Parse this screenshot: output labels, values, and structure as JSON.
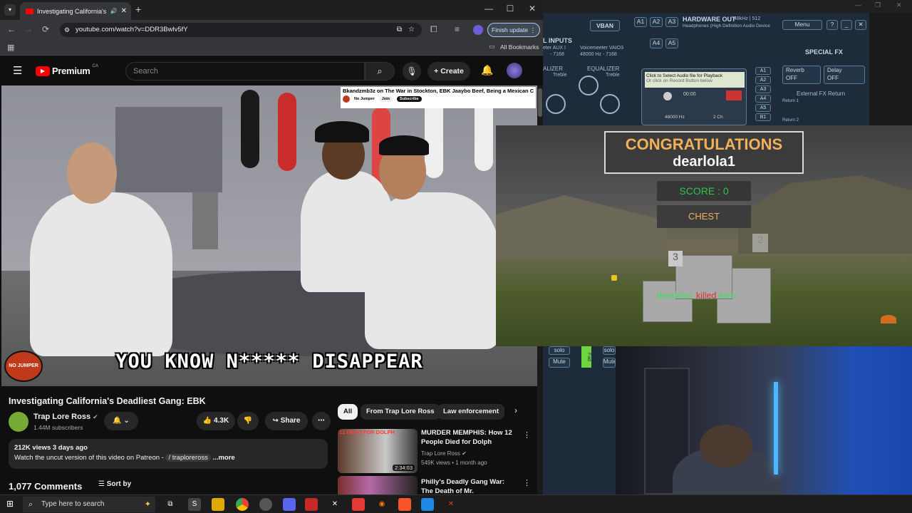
{
  "browser": {
    "tab_title": "Investigating California's De",
    "address": "youtube.com/watch?v=DDR3Bwlv5fY",
    "finish_update": "Finish update",
    "all_bookmarks": "All Bookmarks"
  },
  "youtube": {
    "logo_text": "Premium",
    "logo_region": "CA",
    "search_placeholder": "Search",
    "create_label": "Create",
    "video": {
      "caption": "YOU KNOW N***** DISAPPEAR",
      "logo_text": "NO JUMPER",
      "promo_text": "Bkandzmb3z on The War in Stockton, EBK Jaaybo Beef, Being a Mexican Crip",
      "promo_channel": "No Jumper",
      "promo_join": "Join",
      "promo_subscribe": "Subscribe"
    },
    "title": "Investigating California's Deadliest Gang: EBK",
    "channel_name": "Trap Lore Ross",
    "subscribers": "1.44M subscribers",
    "likes": "4.3K",
    "share_label": "Share",
    "stats": "212K views  3 days ago",
    "description": "Watch the uncut version of this video on Patreon -",
    "description_link": "/ traploreross",
    "more_label": "...more",
    "comments_count": "1,077 Comments",
    "sort_label": "Sort by",
    "chips": [
      "All",
      "From Trap Lore Ross",
      "Law enforcement"
    ],
    "recommendations": [
      {
        "title": "MURDER MEMPHIS: How 12 People Died for Dolph",
        "channel": "Trap Lore Ross",
        "meta": "549K views • 1 month ago",
        "duration": "2:34:03",
        "thumb_text": "12 DEAD FOR DOLPH"
      },
      {
        "title": "Philly's Deadly Gang War: The Death of Mr. Disrespectful",
        "channel": "",
        "meta": "",
        "duration": "",
        "thumb_text": ""
      }
    ]
  },
  "voicemeeter": {
    "vban": "VBAN",
    "hardware_out": "HARDWARE OUT",
    "hw_rate": "48kHz | 512",
    "hw_device": "Headphones (High Definition Audio Device",
    "menu": "Menu",
    "virtual_inputs": "L INPUTS",
    "voicemeeter_aux": "eter AUX I",
    "voicemeeter_vaio": "Voicemeeter VAIO3",
    "rate_left": "- 7168",
    "rate_right": "48000 Hz - 7168",
    "special_fx": "SPECIAL FX",
    "equalizer_1": "ALIZER",
    "equalizer_2": "EQUALIZER",
    "treble": "Treble",
    "playback_hint": "Click to Select Audio file for Playback",
    "record_hint": "Or click on Record Button below",
    "time": "00:00",
    "sample_rate": "48000 Hz",
    "channels": "2 Ch",
    "reverb": "Reverb",
    "reverb_state": "OFF",
    "delay": "Delay",
    "delay_state": "OFF",
    "external_fx": "External FX Return",
    "return1": "Return 1",
    "return2": "Return 2",
    "buses_a": [
      "A1",
      "A2",
      "A3"
    ],
    "buses_b": [
      "A4",
      "A5"
    ],
    "bus_list": [
      "A1",
      "A2",
      "A3",
      "A4",
      "A5",
      "B1"
    ],
    "solo": "solo",
    "mute": "Mute",
    "fader": "Fad"
  },
  "game": {
    "congrats": "CONGRATULATIONS",
    "player": "dearlola1",
    "score": "SCORE : 0",
    "chest": "CHEST",
    "kill_attacker": "dearlola1",
    "kill_verb": "killed",
    "kill_victim": "kcrn",
    "tower_left": "3",
    "tower_right": "2"
  },
  "taskbar": {
    "search_placeholder": "Type here to search"
  }
}
